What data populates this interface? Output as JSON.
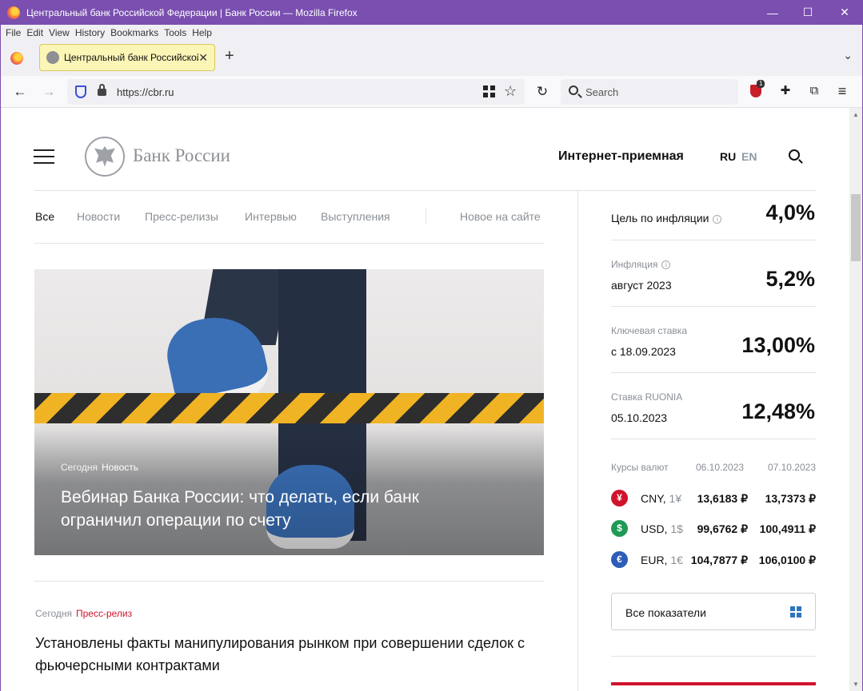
{
  "window": {
    "title": "Центральный банк Российской Федерации | Банк России — Mozilla Firefox",
    "minimize": "—",
    "maximize": "☐",
    "close": "✕",
    "frame_color": "#7a4fb0"
  },
  "menu": [
    "File",
    "Edit",
    "View",
    "History",
    "Bookmarks",
    "Tools",
    "Help"
  ],
  "tab": {
    "label": "Центральный банк Российской Федерации",
    "close": "✕",
    "new_tab": "+",
    "list_all": "⌄"
  },
  "nav": {
    "back": "←",
    "forward": "→",
    "reload": "↻",
    "url": "https://cbr.ru",
    "search_placeholder": "Search",
    "extension_badge": "1",
    "bookmark_star": "☆",
    "menu_icon": "≡",
    "extensions_icon": "⧉",
    "addon_icon": "✚"
  },
  "site": {
    "logo_text": "Банк России",
    "reception": "Интернет-приемная",
    "lang_ru": "RU",
    "lang_en": "EN",
    "accent": "#d0132c"
  },
  "filters": {
    "all": "Все",
    "news": "Новости",
    "press": "Пресс-релизы",
    "interviews": "Интервью",
    "speeches": "Выступления",
    "new_on_site": "Новое на сайте"
  },
  "hero": {
    "date": "Сегодня",
    "type": "Новость",
    "headline": "Вебинар Банка России: что делать, если банк ограничил операции по счету"
  },
  "news": {
    "date": "Сегодня",
    "type": "Пресс-релиз",
    "headline": "Установлены факты манипулирования рынком при совершении сделок с фьючерсными контрактами"
  },
  "indicators": {
    "target": {
      "label": "Цель по инфляции",
      "value": "4,0%"
    },
    "inflation": {
      "small": "Инфляция",
      "label": "август 2023",
      "value": "5,2%"
    },
    "key_rate": {
      "small": "Ключевая ставка",
      "label": "с 18.09.2023",
      "value": "13,00%"
    },
    "ruonia": {
      "small": "Ставка RUONIA",
      "label": "05.10.2023",
      "value": "12,48%"
    },
    "info_icon": "i"
  },
  "fx": {
    "header": "Курсы валют",
    "date1": "06.10.2023",
    "date2": "07.10.2023",
    "rows": [
      {
        "symbol": "¥",
        "code": "CNY,",
        "unit": "1¥",
        "v1": "13,6183 ₽",
        "v2": "13,7373 ₽",
        "color": "#d0132c"
      },
      {
        "symbol": "$",
        "code": "USD,",
        "unit": "1$",
        "v1": "99,6762 ₽",
        "v2": "100,4911 ₽",
        "color": "#1f9a55"
      },
      {
        "symbol": "€",
        "code": "EUR,",
        "unit": "1€",
        "v1": "104,7877 ₽",
        "v2": "106,0100 ₽",
        "color": "#2c5db8"
      }
    ]
  },
  "all_indicators": "Все показатели"
}
